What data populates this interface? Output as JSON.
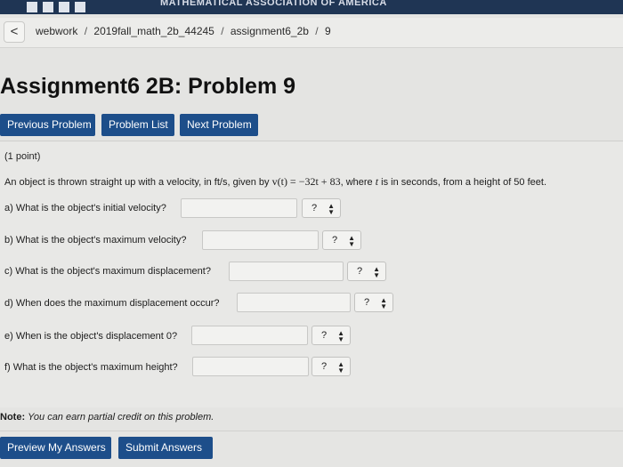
{
  "banner": {
    "text": "MATHEMATICAL ASSOCIATION OF AMERICA"
  },
  "breadcrumb": {
    "back_symbol": "<",
    "items": [
      "webwork",
      "2019fall_math_2b_44245",
      "assignment6_2b",
      "9"
    ],
    "separator": "/"
  },
  "page_title": "Assignment6 2B: Problem 9",
  "nav": {
    "previous": "Previous Problem",
    "list": "Problem List",
    "next": "Next Problem"
  },
  "problem": {
    "points": "(1 point)",
    "statement_before": "An object is thrown straight up with a velocity, in ft/s, given by ",
    "statement_math": "v(t) = −32t + 83",
    "statement_where": ", where ",
    "statement_var": "t",
    "statement_after": " is in seconds, from a height of 50 feet.",
    "questions": [
      {
        "label": "a) What is the object's initial velocity?",
        "value": "",
        "help": "?"
      },
      {
        "label": "b) What is the object's maximum velocity?",
        "value": "",
        "help": "?"
      },
      {
        "label": "c) What is the object's maximum displacement?",
        "value": "",
        "help": "?"
      },
      {
        "label": "d) When does the maximum displacement occur?",
        "value": "",
        "help": "?"
      },
      {
        "label": "e) When is the object's displacement 0?",
        "value": "",
        "help": "?"
      },
      {
        "label": "f) What is the object's maximum height?",
        "value": "",
        "help": "?"
      }
    ]
  },
  "note": {
    "bold": "Note:",
    "text": "You can earn partial credit on this problem."
  },
  "actions": {
    "preview": "Preview My Answers",
    "submit": "Submit Answers"
  },
  "colors": {
    "button_blue": "#1d4e8a",
    "banner_navy": "#1f3554",
    "page_bg": "#e4e4e2"
  }
}
